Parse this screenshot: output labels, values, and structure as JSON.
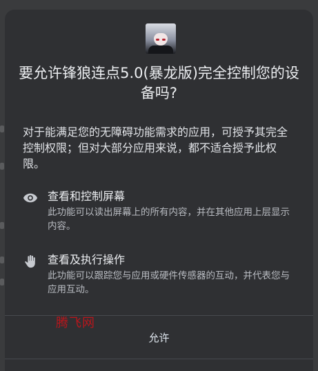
{
  "dialog": {
    "title": "要允许锋狼连点5.0(暴龙版)完全控制您的设备吗?",
    "description": "对于能满足您的无障碍功能需求的应用，可授予其完全控制权限；但对大部分应用来说，都不适合授予此权限。",
    "permissions": [
      {
        "icon": "eye-icon",
        "title": "查看和控制屏幕",
        "description": "此功能可以读出屏幕上的所有内容，并在其他应用上层显示内容。"
      },
      {
        "icon": "hand-icon",
        "title": "查看及执行操作",
        "description": "此功能可以跟踪您与应用或硬件传感器的互动，并代表您与应用互动。"
      }
    ],
    "allow_label": "允许"
  },
  "watermark": "腾飞网",
  "colors": {
    "dialog_bg": "#2f3033",
    "page_bg": "#3a3b3d",
    "watermark": "#b8161c"
  }
}
